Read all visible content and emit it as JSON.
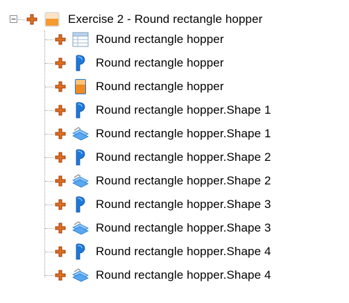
{
  "tree": {
    "root": {
      "label": "Exercise 2 - Round rectangle hopper",
      "icon": "part-folder-icon",
      "expander_state": "expanded"
    },
    "children": [
      {
        "label": "Round rectangle hopper",
        "icon": "table-icon"
      },
      {
        "label": "Round rectangle hopper",
        "icon": "blue-part-icon"
      },
      {
        "label": "Round rectangle hopper",
        "icon": "orange-part-icon"
      },
      {
        "label": "Round rectangle hopper.Shape 1",
        "icon": "blue-part-icon"
      },
      {
        "label": "Round rectangle hopper.Shape 1",
        "icon": "sheet-metal-icon"
      },
      {
        "label": "Round rectangle hopper.Shape 2",
        "icon": "blue-part-icon"
      },
      {
        "label": "Round rectangle hopper.Shape 2",
        "icon": "sheet-metal-icon"
      },
      {
        "label": "Round rectangle hopper.Shape 3",
        "icon": "blue-part-icon"
      },
      {
        "label": "Round rectangle hopper.Shape 3",
        "icon": "sheet-metal-icon"
      },
      {
        "label": "Round rectangle hopper.Shape 4",
        "icon": "blue-part-icon"
      },
      {
        "label": "Round rectangle hopper.Shape 4",
        "icon": "sheet-metal-icon"
      }
    ]
  },
  "colors": {
    "plus_orange": "#e07020",
    "plus_dark": "#9a3a08",
    "part_blue": "#1e78d8",
    "part_orange": "#f08a20",
    "tree_line": "#a0a0a0"
  }
}
